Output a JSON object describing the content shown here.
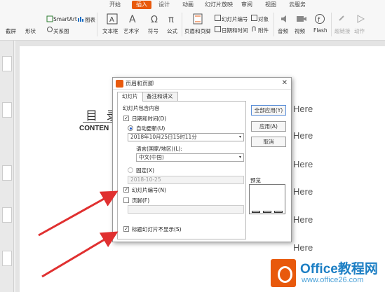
{
  "ribbon": {
    "tabs": [
      "开始",
      "插入",
      "设计",
      "动画",
      "幻灯片放映",
      "审阅",
      "视图",
      "云服务"
    ],
    "active_tab": "插入",
    "items": {
      "screenshot": "截屏",
      "shapes": "形状",
      "smartart": "SmartArt",
      "relation": "关系图",
      "chart": "图表",
      "textbox": "文本框",
      "wordart": "艺术字",
      "symbol": "符号",
      "formula": "公式",
      "header_footer": "页眉和页脚",
      "slide_number": "幻灯片编号",
      "object": "对象",
      "datetime": "日期和时间",
      "attachment": "附件",
      "audio": "音频",
      "video": "视频",
      "flash": "Flash",
      "hyperlink": "超链接",
      "action": "动作"
    }
  },
  "slide": {
    "title": "目 录",
    "subtitle": "CONTEN",
    "here_texts": [
      "Here",
      "Here",
      "Here",
      "Here",
      "Here",
      "Here"
    ]
  },
  "dialog": {
    "title": "页眉和页脚",
    "close_glyph": "✕",
    "tabs": [
      "幻灯片",
      "备注和讲义"
    ],
    "group_label": "幻灯片包含内容",
    "datetime_label": "日期和时间(D)",
    "auto_update_label": "自动更新(U)",
    "date_value": "2018年10月25日15时11分",
    "language_label": "语言(国家/地区)(L):",
    "language_value": "中文(中国)",
    "fixed_label": "固定(X)",
    "fixed_value": "2018-10-25",
    "slide_number_label": "幻灯片编号(N)",
    "footer_label": "页脚(F)",
    "footer_value": "",
    "no_title_label": "标题幻灯片不显示(S)",
    "buttons": {
      "apply_all": "全部应用(Y)",
      "apply": "应用(A)",
      "cancel": "取消"
    },
    "preview_label": "预览",
    "checked_glyph": "✓",
    "dropdown_glyph": "▾"
  },
  "watermark": {
    "title": "Office教程网",
    "url": "www.office26.com"
  },
  "colors": {
    "accent": "#e8590c",
    "watermark_blue": "#1d7fc4",
    "arrow_red": "#e03030"
  }
}
